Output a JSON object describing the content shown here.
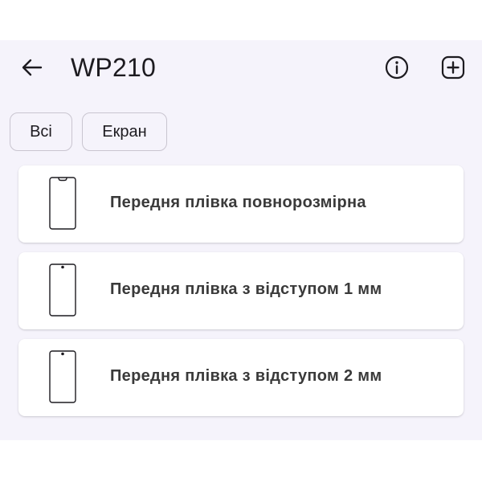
{
  "header": {
    "title": "WP210",
    "back_icon": "arrow-left-icon",
    "info_icon": "info-circle-icon",
    "add_icon": "plus-square-icon"
  },
  "filters": {
    "chips": [
      {
        "label": "Всі"
      },
      {
        "label": "Екран"
      }
    ]
  },
  "items": [
    {
      "label": "Передня плівка повнорозмірна",
      "icon": "phone-notch-icon"
    },
    {
      "label": "Передня плівка з відступом 1 мм",
      "icon": "phone-dot-icon"
    },
    {
      "label": "Передня плівка з відступом 2 мм",
      "icon": "phone-dot-icon"
    }
  ],
  "colors": {
    "background": "#f5f3fb",
    "card": "#ffffff",
    "text": "#1d1b20",
    "chip_border": "#c9c5d0"
  }
}
